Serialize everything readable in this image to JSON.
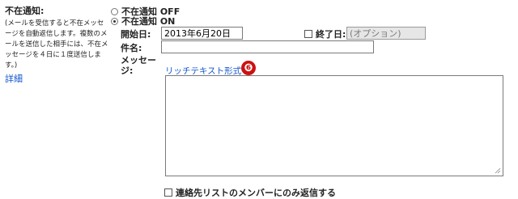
{
  "vacation": {
    "title": "不在通知:",
    "description": "(メールを受信すると不在メッセージを自動返信します。複数のメールを送信した相手には、不在メッセージを４日に１度送信します。)",
    "details_link": "詳細",
    "off_label": "不在通知 OFF",
    "on_label": "不在通知 ON",
    "selected": "on"
  },
  "form": {
    "start_label": "開始日:",
    "start_value": "2013年6月20日",
    "end_label": "終了日:",
    "end_value": "(オプション)",
    "subject_label": "件名:",
    "subject_value": "",
    "message_label": "メッセージ:",
    "rich_text_link": "リッチテキスト形式 »",
    "badge_number": "❻",
    "contacts_only_label": "連絡先リストのメンバーにのみ返信する"
  },
  "colors": {
    "link": "#1155cc",
    "badge": "#cc1111"
  }
}
